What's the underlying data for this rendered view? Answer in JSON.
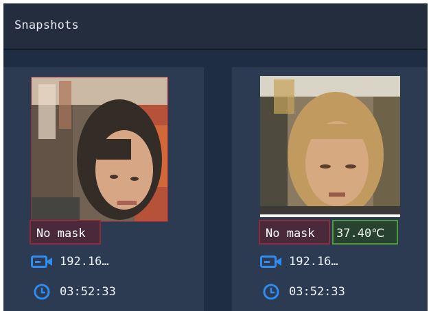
{
  "panel": {
    "title": "Snapshots"
  },
  "colors": {
    "panel_bg": "#24334a",
    "header_bg": "#232d3d",
    "card_bg": "#2c3b52",
    "icon_blue": "#2f8cf0",
    "no_mask_border": "#8d2c3c",
    "temp_border": "#4c9a3a"
  },
  "snapshots": [
    {
      "mask_status": "No mask",
      "ip": "192.16…",
      "time": "03:52:33",
      "icons": {
        "camera": "camera-icon",
        "clock": "clock-icon"
      }
    },
    {
      "mask_status": "No mask",
      "temperature": "37.40℃",
      "ip": "192.16…",
      "time": "03:52:33",
      "icons": {
        "camera": "camera-icon",
        "clock": "clock-icon"
      }
    }
  ]
}
